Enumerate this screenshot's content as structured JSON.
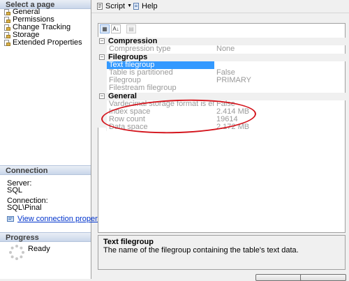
{
  "left_pane": {
    "select_page_heading": "Select a page",
    "pages": [
      {
        "label": "General",
        "icon": "page-wrench-icon"
      },
      {
        "label": "Permissions",
        "icon": "page-wrench-icon"
      },
      {
        "label": "Change Tracking",
        "icon": "page-wrench-icon"
      },
      {
        "label": "Storage",
        "icon": "page-wrench-icon"
      },
      {
        "label": "Extended Properties",
        "icon": "page-wrench-icon"
      }
    ],
    "connection_heading": "Connection",
    "server_label": "Server:",
    "server_value": "SQL",
    "connection_label": "Connection:",
    "connection_value": "SQL\\Pinal",
    "view_connection_link": "View connection properties",
    "progress_heading": "Progress",
    "progress_status": "Ready"
  },
  "toolbar": {
    "script_label": "Script",
    "help_label": "Help"
  },
  "property_grid": {
    "categories": [
      {
        "label": "Compression",
        "properties": [
          {
            "name": "Compression type",
            "value": "None"
          }
        ]
      },
      {
        "label": "Filegroups",
        "properties": [
          {
            "name": "Text filegroup",
            "value": "",
            "selected": true
          },
          {
            "name": "Table is partitioned",
            "value": "False"
          },
          {
            "name": "Filegroup",
            "value": "PRIMARY"
          },
          {
            "name": "Filestream filegroup",
            "value": ""
          }
        ]
      },
      {
        "label": "General",
        "properties": [
          {
            "name": "Vardecimal storage format is enabled",
            "value": "False"
          },
          {
            "name": "Index space",
            "value": "2.414 MB"
          },
          {
            "name": "Row count",
            "value": "19614"
          },
          {
            "name": "Data space",
            "value": "2.172 MB"
          }
        ]
      }
    ]
  },
  "description": {
    "title": "Text filegroup",
    "text": "The name of the filegroup containing the table's text data."
  },
  "colors": {
    "selection": "#3399ff",
    "annotation_circle": "#d4141c",
    "link": "#0033cc"
  }
}
